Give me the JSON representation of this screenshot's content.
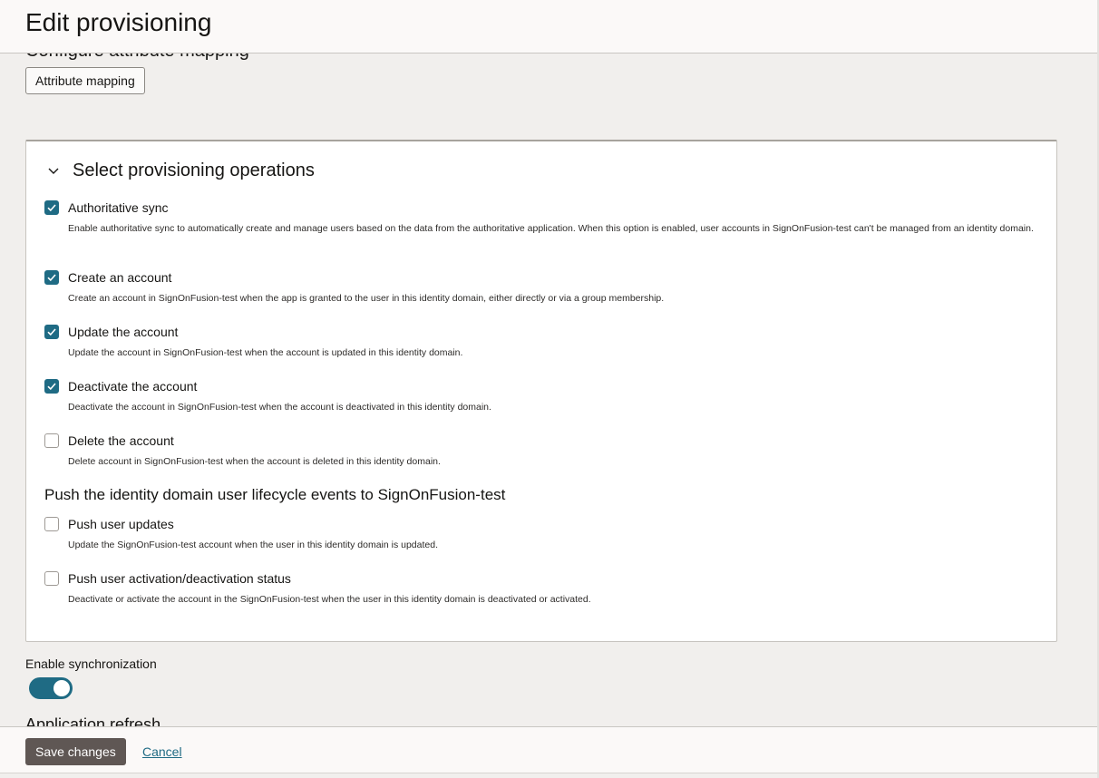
{
  "header": {
    "title": "Edit provisioning"
  },
  "attribute_section": {
    "heading_partial": "Configure attribute mapping",
    "mapping_button": "Attribute mapping"
  },
  "operations": {
    "title": "Select provisioning operations",
    "items": [
      {
        "label": "Authoritative sync",
        "checked": true,
        "description": "Enable authoritative sync to automatically create and manage users based on the data from the authoritative application. When this option is enabled, user accounts in SignOnFusion-test can't be managed from an identity domain."
      },
      {
        "label": "Create an account",
        "checked": true,
        "description": "Create an account in SignOnFusion-test when the app is granted to the user in this identity domain, either directly or via a group membership."
      },
      {
        "label": "Update the account",
        "checked": true,
        "description": "Update the account in SignOnFusion-test when the account is updated in this identity domain."
      },
      {
        "label": "Deactivate the account",
        "checked": true,
        "description": "Deactivate the account in SignOnFusion-test when the account is deactivated in this identity domain."
      },
      {
        "label": "Delete the account",
        "checked": false,
        "description": "Delete account in SignOnFusion-test when the account is deleted in this identity domain."
      }
    ],
    "push_heading": "Push the identity domain user lifecycle events to SignOnFusion-test",
    "push_items": [
      {
        "label": "Push user updates",
        "checked": false,
        "description": "Update the SignOnFusion-test account when the user in this identity domain is updated."
      },
      {
        "label": "Push user activation/deactivation status",
        "checked": false,
        "description": "Deactivate or activate the account in the SignOnFusion-test when the user in this identity domain is deactivated or activated."
      }
    ]
  },
  "sync": {
    "label": "Enable synchronization",
    "enabled": true
  },
  "refresh": {
    "heading_partial": "Application refresh"
  },
  "footer": {
    "save_label": "Save changes",
    "cancel_label": "Cancel"
  },
  "colors": {
    "accent": "#1f6b84",
    "primary_button": "#5f5754"
  },
  "icons": {
    "chevron": "chevron-down-icon",
    "check": "checkmark-icon"
  }
}
